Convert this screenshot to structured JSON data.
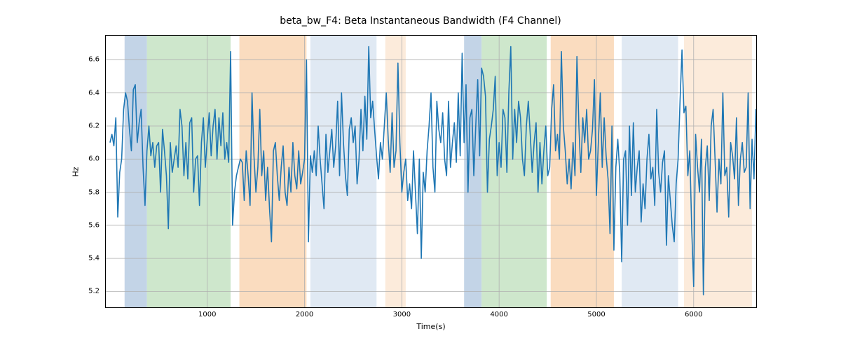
{
  "chart_data": {
    "type": "line",
    "title": "beta_bw_F4: Beta Instantaneous Bandwidth (F4 Channel)",
    "xlabel": "Time(s)",
    "ylabel": "Hz",
    "xlim": [
      -50,
      6650
    ],
    "ylim": [
      5.1,
      6.75
    ],
    "xticks": [
      1000,
      2000,
      3000,
      4000,
      5000,
      6000
    ],
    "yticks": [
      5.2,
      5.4,
      5.6,
      5.8,
      6.0,
      6.2,
      6.4,
      6.6
    ],
    "bands": [
      {
        "x0": 150,
        "x1": 380,
        "color": "#b9cde3"
      },
      {
        "x0": 380,
        "x1": 1240,
        "color": "#c6e3c3"
      },
      {
        "x0": 1330,
        "x1": 2020,
        "color": "#f9d6b4"
      },
      {
        "x0": 2060,
        "x1": 2740,
        "color": "#dbe5f1"
      },
      {
        "x0": 2830,
        "x1": 3040,
        "color": "#fbe8d5"
      },
      {
        "x0": 3640,
        "x1": 3820,
        "color": "#b9cde3"
      },
      {
        "x0": 3820,
        "x1": 4490,
        "color": "#c6e3c3"
      },
      {
        "x0": 4530,
        "x1": 5180,
        "color": "#f9d6b4"
      },
      {
        "x0": 5260,
        "x1": 5840,
        "color": "#dbe5f1"
      },
      {
        "x0": 5900,
        "x1": 6600,
        "color": "#fbe8d5"
      }
    ],
    "series": [
      {
        "name": "beta_bw_F4",
        "color": "#1f77b4",
        "x_step": 20,
        "values": [
          6.1,
          6.15,
          6.08,
          6.25,
          5.65,
          5.92,
          6.0,
          6.3,
          6.4,
          6.35,
          6.18,
          6.05,
          6.42,
          6.45,
          6.1,
          6.22,
          6.3,
          5.95,
          5.72,
          6.05,
          6.2,
          6.02,
          6.1,
          5.95,
          6.08,
          6.1,
          5.8,
          6.18,
          6.05,
          5.9,
          5.58,
          6.1,
          5.92,
          6.0,
          6.08,
          5.95,
          6.3,
          6.2,
          5.9,
          6.1,
          5.88,
          6.22,
          6.25,
          5.8,
          6.0,
          6.02,
          5.72,
          6.1,
          6.25,
          5.95,
          6.12,
          6.28,
          6.02,
          6.2,
          6.3,
          6.0,
          6.25,
          6.08,
          6.28,
          6.0,
          6.1,
          5.98,
          6.65,
          5.6,
          5.8,
          5.9,
          5.95,
          6.0,
          5.98,
          5.75,
          6.05,
          5.9,
          5.72,
          6.4,
          6.02,
          5.8,
          5.95,
          6.3,
          5.9,
          6.05,
          5.75,
          5.95,
          5.7,
          5.5,
          6.05,
          6.1,
          5.9,
          5.75,
          5.95,
          6.08,
          5.8,
          5.72,
          5.95,
          5.8,
          6.1,
          5.9,
          5.82,
          6.05,
          5.85,
          5.92,
          6.0,
          6.6,
          5.5,
          6.02,
          5.92,
          6.05,
          5.9,
          6.2,
          6.0,
          5.85,
          5.7,
          6.15,
          5.92,
          6.05,
          6.18,
          5.95,
          6.08,
          6.35,
          5.9,
          6.4,
          6.1,
          5.9,
          5.78,
          6.18,
          6.25,
          6.1,
          6.2,
          5.85,
          6.0,
          6.3,
          6.05,
          6.38,
          6.12,
          6.68,
          6.25,
          6.35,
          6.18,
          6.02,
          5.88,
          6.1,
          6.0,
          6.2,
          6.4,
          6.12,
          5.92,
          6.28,
          5.95,
          6.05,
          6.58,
          6.1,
          5.8,
          5.92,
          6.0,
          5.75,
          5.85,
          5.7,
          6.05,
          5.8,
          5.55,
          6.0,
          5.4,
          5.92,
          5.8,
          6.05,
          6.2,
          6.4,
          5.95,
          5.8,
          6.35,
          6.18,
          6.1,
          6.28,
          6.0,
          5.9,
          6.35,
          5.95,
          6.1,
          6.22,
          5.98,
          6.4,
          6.02,
          6.64,
          6.1,
          6.45,
          5.8,
          6.25,
          6.3,
          5.9,
          6.2,
          6.48,
          6.02,
          6.55,
          6.5,
          6.38,
          5.8,
          6.12,
          6.2,
          6.3,
          6.5,
          5.9,
          6.1,
          5.95,
          6.3,
          6.25,
          5.92,
          6.4,
          6.68,
          6.0,
          6.3,
          6.1,
          6.35,
          6.25,
          6.0,
          5.9,
          6.2,
          6.35,
          6.15,
          5.92,
          6.1,
          6.22,
          5.8,
          6.1,
          5.85,
          6.05,
          6.2,
          5.9,
          5.95,
          6.3,
          6.45,
          6.05,
          6.15,
          6.0,
          6.65,
          6.2,
          6.05,
          5.85,
          6.0,
          5.82,
          6.1,
          5.9,
          6.62,
          6.2,
          5.92,
          6.25,
          6.1,
          6.3,
          6.0,
          6.05,
          6.18,
          6.48,
          5.78,
          6.1,
          6.4,
          5.95,
          6.25,
          6.02,
          5.88,
          5.55,
          6.2,
          5.45,
          5.95,
          6.12,
          5.92,
          5.38,
          6.0,
          6.05,
          5.6,
          6.2,
          5.78,
          6.22,
          5.8,
          5.95,
          6.05,
          5.62,
          5.85,
          5.7,
          6.0,
          6.15,
          5.88,
          5.95,
          5.72,
          6.3,
          5.92,
          5.8,
          5.98,
          6.05,
          5.48,
          5.9,
          5.75,
          5.6,
          5.5,
          5.85,
          6.0,
          6.35,
          6.66,
          6.28,
          6.32,
          5.9,
          6.05,
          5.58,
          5.23,
          6.15,
          5.95,
          5.8,
          6.12,
          5.18,
          5.95,
          6.08,
          5.75,
          6.2,
          6.3,
          6.0,
          5.68,
          6.0,
          5.85,
          6.4,
          5.9,
          5.95,
          5.65,
          6.1,
          6.02,
          5.88,
          6.25,
          5.72,
          6.0,
          6.1,
          5.92,
          5.95,
          6.4,
          5.7,
          6.12,
          5.88,
          6.3,
          5.95,
          6.05
        ]
      }
    ]
  }
}
